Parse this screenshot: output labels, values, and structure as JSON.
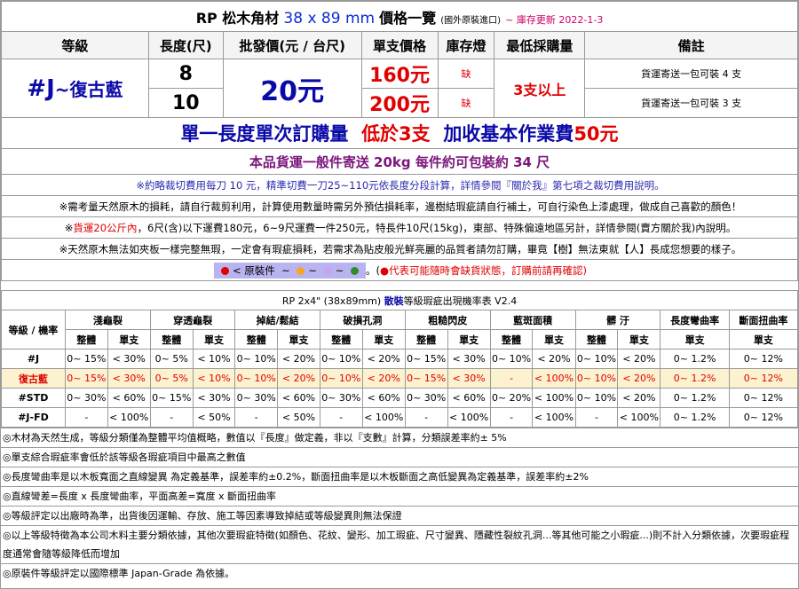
{
  "title": {
    "prefix": "RP 松木角材",
    "dim": "38 x 89 mm",
    "suffix": "價格一覽",
    "sub": "(國外原裝進口)",
    "update": "~ 庫存更新 2022-1-3"
  },
  "headers": [
    "等級",
    "長度(尺)",
    "批發價(元 / 台尺)",
    "單支價格",
    "庫存燈",
    "最低採購量",
    "備註"
  ],
  "product": {
    "grade": "#J",
    "grade_suffix": "~復古藍",
    "wholesale": "20元",
    "min_order": "3支以上",
    "rows": [
      {
        "length": "8",
        "unit_price": "160元",
        "stock": "缺",
        "note": "貨運寄送一包可裝 4 支"
      },
      {
        "length": "10",
        "unit_price": "200元",
        "stock": "缺",
        "note": "貨運寄送一包可裝 3 支"
      }
    ]
  },
  "banner1": {
    "a": "單一長度單次訂購量",
    "b": "低於3支",
    "c": "加收基本作業費",
    "d": "50元"
  },
  "banner2": "本品貨運一般件寄送 20kg 每件約可包裝約 34 尺",
  "notes": {
    "n1": "※約略裁切費用每刀 10 元，精準切費一刀25~110元依長度分段計算，詳情參閱『關於我』第七項之裁切費用說明。",
    "n2": "※需考量天然原木的損耗，請自行裁剪利用，計算使用數量時需另外預估損耗率，邊樹結瑕疵請自行補土，可自行染色上漆處理，做成自己喜歡的顏色！",
    "n3a": "※",
    "n3b": "貨運20公斤內",
    "n3c": "，6尺(含)以下運費180元，6~9尺運費一件250元，特長件10尺(15kg)，東部、特殊偏遠地區另計，詳情參閱(賣方關於我)內說明。",
    "n4": "※天然原木無法如夾板一樣完整無瑕，一定會有瑕疵損耗，若需求為貼皮般光鮮亮麗的品質者請勿訂購，畢竟【樹】無法東就【人】長成您想要的樣子。",
    "n5a": "< 原裝件",
    "n5b": "~",
    "n5c": "~",
    "n5d": "。(",
    "n5e": "●代表可能隨時會缺貨狀態，訂購前請再確認)"
  },
  "colors": {
    "red": "#e10000",
    "blue": "#0a0aa8",
    "purple": "#7b157b",
    "orange": "#f5a623",
    "violet": "#c8a2f0",
    "green": "#2e8b2e",
    "vintage_bg": "#fdf2cf"
  },
  "defects": {
    "title_a": "RP 2x4\" (38x89mm)",
    "title_b": "散裝",
    "title_c": "等級瑕疵出現機率表 V2.4",
    "rowhead": "等級 / 機率",
    "groups": [
      "淺龜裂",
      "穿透龜裂",
      "掉結/鬆結",
      "破損孔洞",
      "粗糙閃皮",
      "藍斑面積",
      "髒 汙",
      "長度彎曲率",
      "斷面扭曲率"
    ],
    "sub_whole": "整體",
    "sub_single": "單支",
    "rows": [
      {
        "grade": "#J",
        "cells": [
          "0~ 15%",
          "< 30%",
          "0~ 5%",
          "< 10%",
          "0~ 10%",
          "< 20%",
          "0~ 10%",
          "< 20%",
          "0~ 15%",
          "< 30%",
          "0~ 10%",
          "< 20%",
          "0~ 10%",
          "< 20%",
          "0~ 1.2%",
          "0~ 12%"
        ]
      },
      {
        "grade": "復古藍",
        "cells": [
          "0~ 15%",
          "< 30%",
          "0~ 5%",
          "< 10%",
          "0~ 10%",
          "< 20%",
          "0~ 10%",
          "< 20%",
          "0~ 15%",
          "< 30%",
          "-",
          "< 100%",
          "0~ 10%",
          "< 20%",
          "0~ 1.2%",
          "0~ 12%"
        ]
      },
      {
        "grade": "#STD",
        "cells": [
          "0~ 30%",
          "< 60%",
          "0~ 15%",
          "< 30%",
          "0~ 30%",
          "< 60%",
          "0~ 30%",
          "< 60%",
          "0~ 30%",
          "< 60%",
          "0~ 20%",
          "< 100%",
          "0~ 10%",
          "< 20%",
          "0~ 1.2%",
          "0~ 12%"
        ]
      },
      {
        "grade": "#J-FD",
        "cells": [
          "-",
          "< 100%",
          "-",
          "< 50%",
          "-",
          "< 50%",
          "-",
          "< 100%",
          "-",
          "< 100%",
          "-",
          "< 100%",
          "-",
          "< 100%",
          "0~ 1.2%",
          "0~ 12%"
        ]
      }
    ]
  },
  "footnotes": [
    "◎木材為天然生成，等級分類僅為整體平均值概略，數值以『長度』做定義，非以『支數』計算，分類誤差率約± 5%",
    "◎單支綜合瑕疵率會低於該等級各瑕疵項目中最高之數值",
    "◎長度彎曲率是以木板寬面之直線變異 為定義基準，誤差率約±0.2%，斷面扭曲率是以木板斷面之高低變異為定義基準，誤差率約±2%",
    "◎直線彎差=長度 x 長度彎曲率，平面高差=寬度 x 斷面扭曲率",
    "◎等級評定以出廠時為準，出貨後因運輸、存放、施工等因素導致掉結或等級變異則無法保證",
    "◎以上等級特徵為本公司木料主要分類依據，其他次要瑕疵特徵(如顏色、花紋、變形、加工瑕疵、尺寸變異、隱藏性裂紋孔洞...等其他可能之小瑕疵...)則不計入分類依據，次要瑕疵程度通常會隨等級降低而增加",
    "◎原裝件等級評定以國際標準 Japan-Grade 為依據。"
  ]
}
